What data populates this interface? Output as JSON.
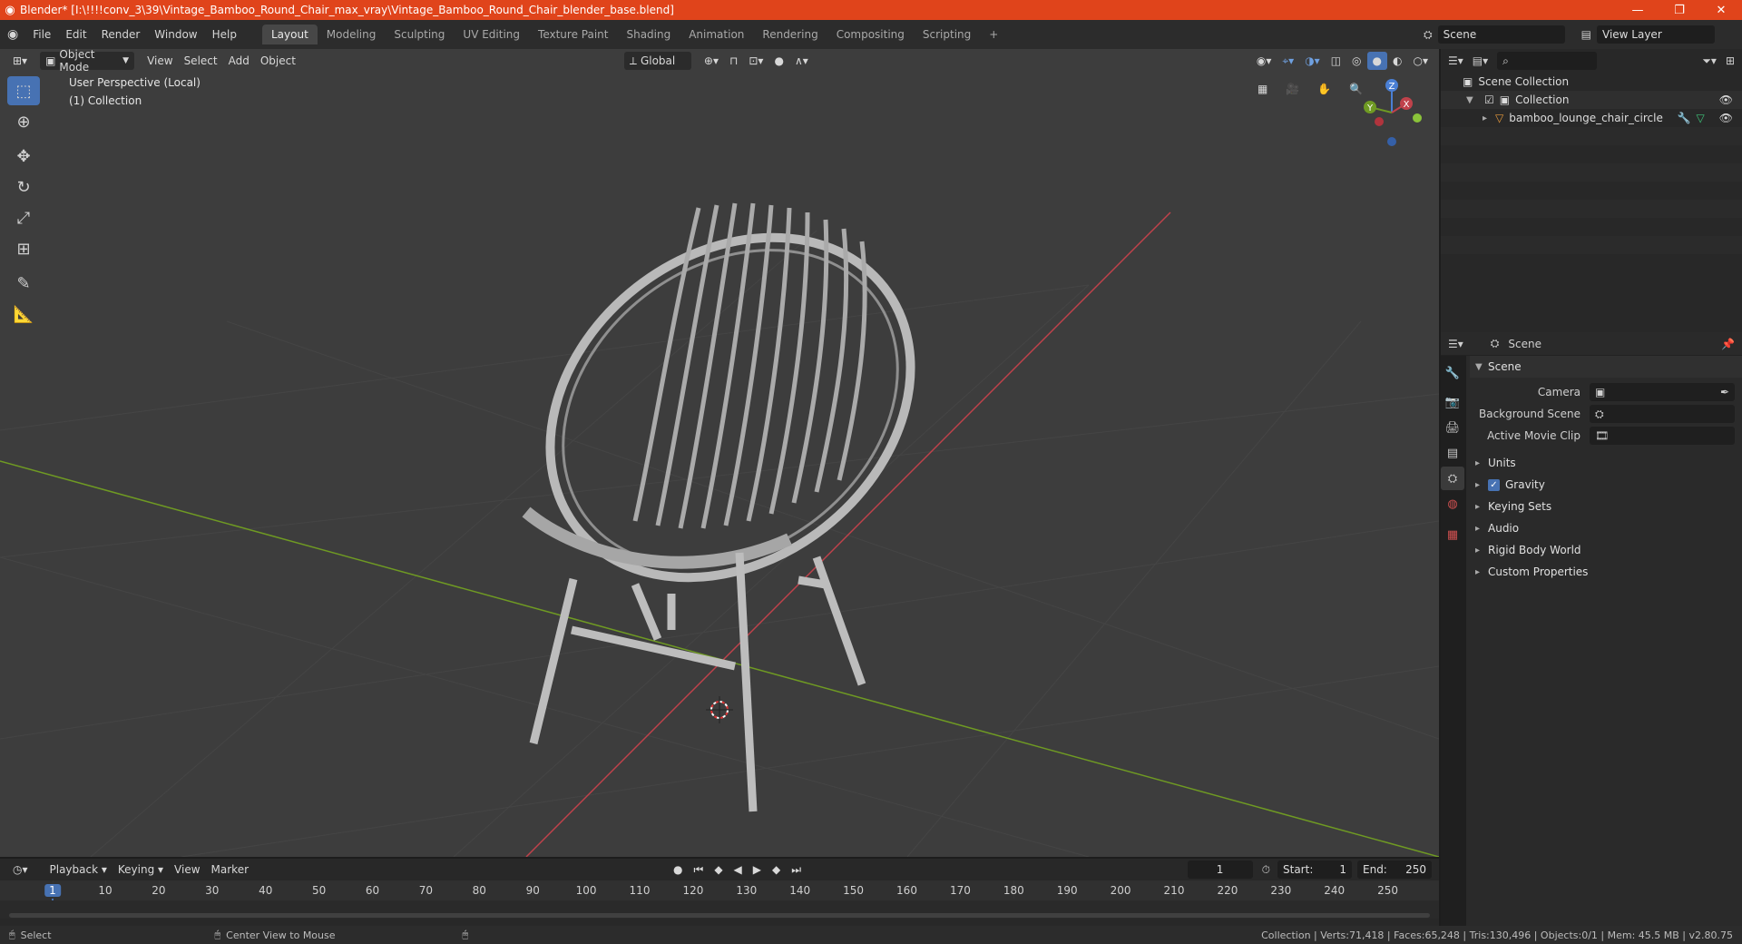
{
  "titlebar": {
    "title": "Blender* [I:\\!!!!conv_3\\39\\Vintage_Bamboo_Round_Chair_max_vray\\Vintage_Bamboo_Round_Chair_blender_base.blend]",
    "minimize": "—",
    "maximize": "❐",
    "close": "✕"
  },
  "menu": {
    "items": [
      "File",
      "Edit",
      "Render",
      "Window",
      "Help"
    ]
  },
  "workspaces": [
    "Layout",
    "Modeling",
    "Sculpting",
    "UV Editing",
    "Texture Paint",
    "Shading",
    "Animation",
    "Rendering",
    "Compositing",
    "Scripting"
  ],
  "add_workspace": "+",
  "scene_selector": {
    "value": "Scene"
  },
  "view_layer_selector": {
    "value": "View Layer"
  },
  "viewport_header": {
    "mode": "Object Mode",
    "menus": [
      "View",
      "Select",
      "Add",
      "Object"
    ],
    "orientation": "Global"
  },
  "viewport_overlay": {
    "line1": "User Perspective (Local)",
    "line2": "(1) Collection"
  },
  "gizmo": {
    "z": "Z",
    "y": "Y",
    "x": "X"
  },
  "outliner": {
    "root": "Scene Collection",
    "collection": "Collection",
    "object": "bamboo_lounge_chair_circle"
  },
  "properties": {
    "header": "Scene",
    "panel_title": "Scene",
    "camera_label": "Camera",
    "background_scene_label": "Background Scene",
    "active_movie_clip_label": "Active Movie Clip",
    "subpanels": [
      "Units",
      "Gravity",
      "Keying Sets",
      "Audio",
      "Rigid Body World",
      "Custom Properties"
    ]
  },
  "timeline": {
    "menus": [
      "Playback",
      "Keying",
      "View",
      "Marker"
    ],
    "current_frame": "1",
    "start_label": "Start:",
    "start_value": "1",
    "end_label": "End:",
    "end_value": "250",
    "ticks": [
      "1",
      "10",
      "20",
      "30",
      "40",
      "50",
      "60",
      "70",
      "80",
      "90",
      "100",
      "110",
      "120",
      "130",
      "140",
      "150",
      "160",
      "170",
      "180",
      "190",
      "200",
      "210",
      "220",
      "230",
      "240",
      "250"
    ]
  },
  "statusbar": {
    "left_action": "Select",
    "mid_action": "Center View to Mouse",
    "stats": "Collection | Verts:71,418 | Faces:65,248 | Tris:130,496 | Objects:0/1 | Mem: 45.5 MB | v2.80.75"
  },
  "colors": {
    "title_bar": "#e0441b",
    "accent_blue": "#4772b3",
    "x_axis": "#c0424b",
    "y_axis": "#6f9a23"
  }
}
